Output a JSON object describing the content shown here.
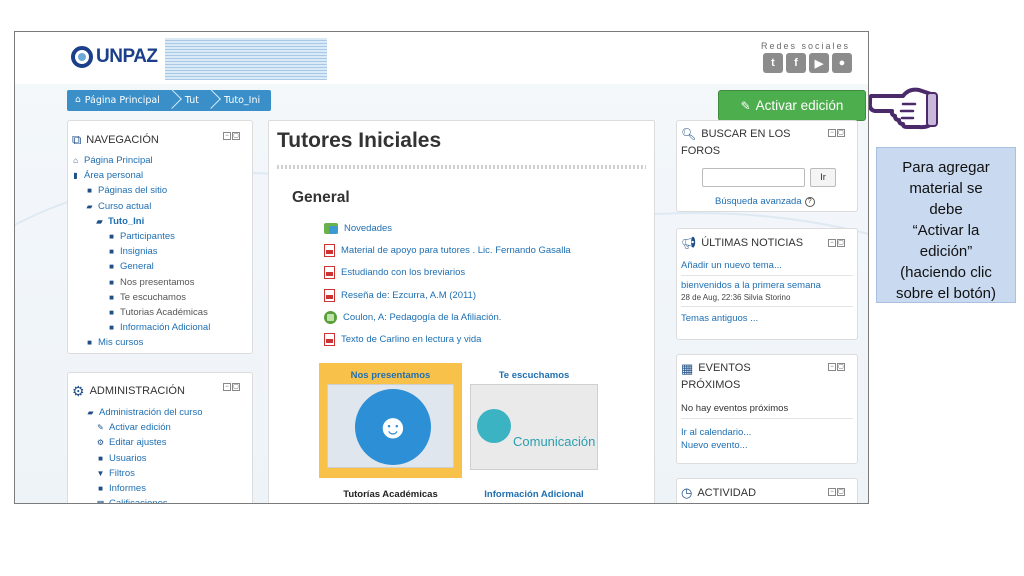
{
  "header": {
    "logo_text": "UNPAZ",
    "redes_label": "Redes sociales",
    "social_icons": [
      "twitter-icon",
      "facebook-icon",
      "youtube-icon",
      "moodle-icon"
    ]
  },
  "breadcrumb": [
    "Página Principal",
    "Tut",
    "Tuto_Ini"
  ],
  "activar_button": "Activar edición",
  "navegacion": {
    "title": "NAVEGACIÓN",
    "items": [
      {
        "label": "Página Principal",
        "icon": "home-icon"
      },
      {
        "label": "Área personal",
        "icon": "page-icon"
      },
      {
        "label": "Páginas del sitio",
        "icon": "folder-icon"
      },
      {
        "label": "Curso actual",
        "icon": "folder-open-icon"
      },
      {
        "label": "Tuto_Ini",
        "icon": "folder-open-icon"
      },
      {
        "label": "Participantes",
        "icon": "folder-icon"
      },
      {
        "label": "Insignias",
        "icon": "folder-icon"
      },
      {
        "label": "General",
        "icon": "folder-icon"
      },
      {
        "label": "Nos presentamos",
        "icon": "folder-icon"
      },
      {
        "label": "Te escuchamos",
        "icon": "folder-icon"
      },
      {
        "label": "Tutorias Académicas",
        "icon": "folder-icon"
      },
      {
        "label": "Información Adicional",
        "icon": "folder-icon"
      },
      {
        "label": "Mis cursos",
        "icon": "folder-icon"
      }
    ]
  },
  "administracion": {
    "title": "ADMINISTRACIÓN",
    "items": [
      {
        "label": "Administración del curso",
        "icon": "folder-open-icon"
      },
      {
        "label": "Activar edición",
        "icon": "pencil-icon"
      },
      {
        "label": "Editar ajustes",
        "icon": "gears-icon"
      },
      {
        "label": "Usuarios",
        "icon": "folder-icon"
      },
      {
        "label": "Filtros",
        "icon": "filter-icon"
      },
      {
        "label": "Informes",
        "icon": "folder-icon"
      },
      {
        "label": "Calificaciones",
        "icon": "table-icon"
      }
    ]
  },
  "main": {
    "title": "Tutores Iniciales",
    "section": "General",
    "activities": [
      {
        "label": "Novedades",
        "icon": "forum-icon"
      },
      {
        "label": "Material de apoyo para tutores . Lic. Fernando Gasalla",
        "icon": "pdf-icon"
      },
      {
        "label": "Estudiando con los breviarios",
        "icon": "pdf-icon"
      },
      {
        "label": "Reseña de: Ezcurra, A.M (2011)",
        "icon": "pdf-icon"
      },
      {
        "label": "Coulon, A: Pedagogía de la Afiliación.",
        "icon": "book-icon"
      },
      {
        "label": "Texto de Carlino en lectura y vida",
        "icon": "pdf-icon"
      }
    ],
    "tiles": [
      {
        "label": "Nos presentamos"
      },
      {
        "label": "Te escuchamos",
        "image_text": "Comunicación"
      },
      {
        "label": "Tutorías Académicas"
      },
      {
        "label": "Información Adicional"
      }
    ]
  },
  "buscar": {
    "title_line1": "BUSCAR EN LOS",
    "title_line2": "FOROS",
    "input_value": "",
    "go_button": "Ir",
    "advanced_link": "Búsqueda avanzada"
  },
  "noticias": {
    "title": "ÚLTIMAS NOTICIAS",
    "add_link": "Añadir un nuevo tema...",
    "post_title": "bienvenidos a la primera semana",
    "post_meta": "28 de Aug, 22:36 Silvia Storino",
    "old_link": "Temas antiguos ..."
  },
  "eventos": {
    "title_line1": "EVENTOS",
    "title_line2": "PRÓXIMOS",
    "none_text": "No hay eventos próximos",
    "calendar_link": "Ir al calendario...",
    "new_link": "Nuevo evento..."
  },
  "actividad": {
    "title": "ACTIVIDAD"
  },
  "callout": {
    "line1": "Para agregar",
    "line2": "material se",
    "line3": "debe",
    "line4": "“Activar la",
    "line5": "edición”",
    "line6": "(haciendo clic",
    "line7": "sobre el botón)"
  },
  "colors": {
    "accent_blue": "#3a8fc9",
    "link_blue": "#1f6fb2",
    "button_green": "#4cae4c",
    "callout_bg": "#c9daf0"
  }
}
